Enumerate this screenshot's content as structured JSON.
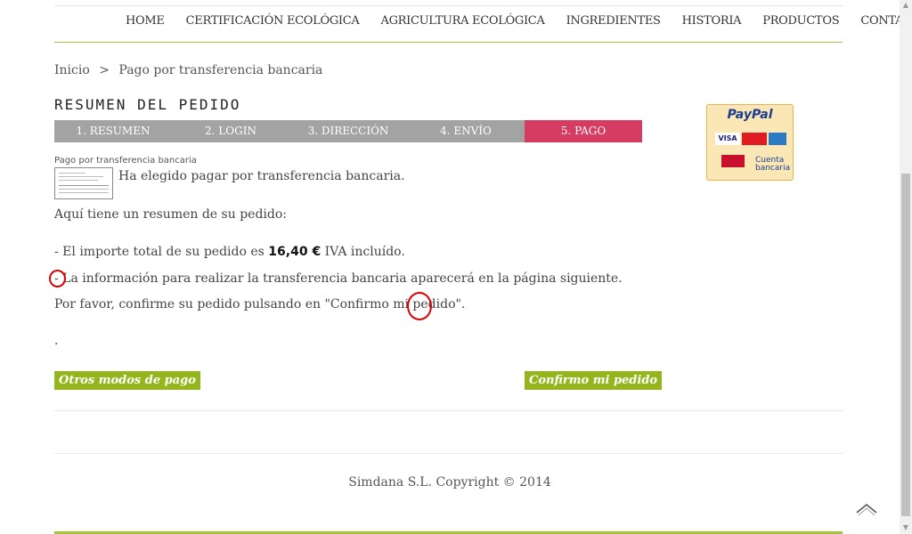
{
  "nav": {
    "items": [
      "HOME",
      "CERTIFICACIÓN ECOLÓGICA",
      "AGRICULTURA ECOLÓGICA",
      "INGREDIENTES",
      "HISTORIA",
      "PRODUCTOS",
      "CONTACTO"
    ]
  },
  "breadcrumb": {
    "home": "Inicio",
    "separator": ">",
    "current": "Pago por transferencia bancaria"
  },
  "page_title": "RESUMEN DEL PEDIDO",
  "steps": [
    "1. RESUMEN",
    "2. LOGIN",
    "3. DIRECCIÓN",
    "4. ENVÍO",
    "5. PAGO"
  ],
  "active_step": 4,
  "payment": {
    "label": "Pago por transferencia bancaria",
    "chosen": "Ha elegido pagar por transferencia bancaria.",
    "summary_intro": "Aquí tiene un resumen de su pedido:",
    "total_prefix": "- El importe total de su pedido es",
    "total_amount": "16,40 €",
    "total_suffix": "IVA incluído.",
    "info_line": "- La información para realizar la transferencia bancaria aparecerá en la página siguiente.",
    "confirm_line": "Por favor, confirme su pedido pulsando en \"Confirmo mi pedido\".",
    "dot": "."
  },
  "buttons": {
    "other_methods": "Otros modos de pago",
    "confirm": "Confirmo mi pedido"
  },
  "paypal": {
    "name": "PayPal",
    "cards": [
      "VISA",
      "MasterCard",
      "AMEX"
    ],
    "bank_label_1": "Cuenta",
    "bank_label_2": "bancaria"
  },
  "footer": "Simdana S.L. Copyright © 2014",
  "colors": {
    "accent_green": "#95b51d",
    "active_step": "#d63c61",
    "step_bg": "#a3a3a3"
  }
}
